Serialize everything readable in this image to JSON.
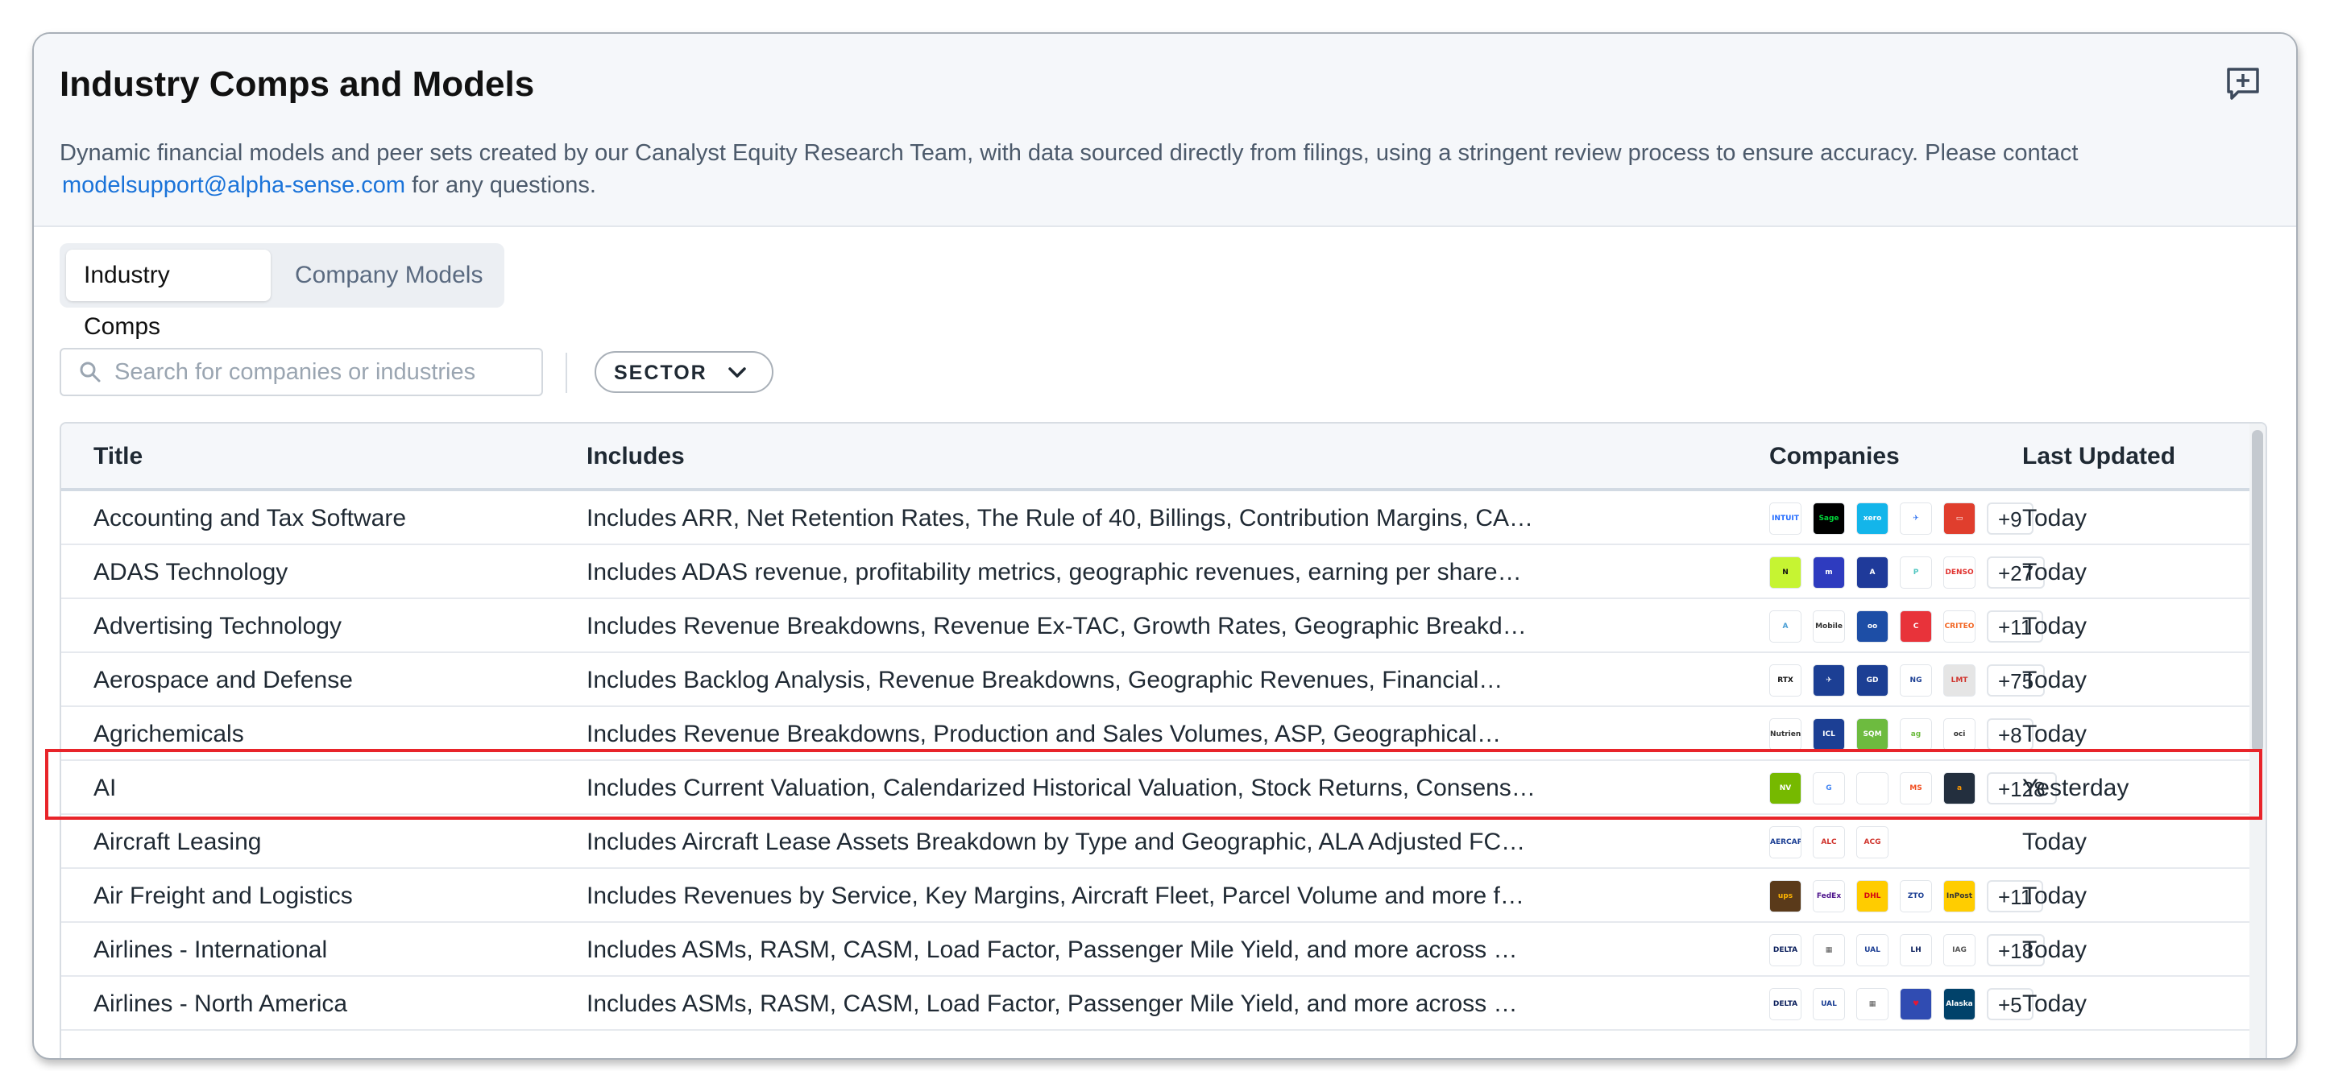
{
  "header": {
    "title": "Industry Comps and Models",
    "description": "Dynamic financial models and peer sets created by our Canalyst Equity Research Team, with data sourced directly from filings, using a stringent review process to ensure accuracy. Please contact",
    "email": "modelsupport@alpha-sense.com",
    "description_suffix": "for any questions.",
    "comment_icon": "add-comment-icon"
  },
  "tabs": [
    {
      "label": "Industry Comps",
      "active": true
    },
    {
      "label": "Company Models",
      "active": false
    }
  ],
  "search": {
    "placeholder": "Search for companies or industries",
    "value": ""
  },
  "filter": {
    "label": "SECTOR"
  },
  "table": {
    "columns": [
      "Title",
      "Includes",
      "Companies",
      "Last Updated"
    ],
    "rows": [
      {
        "title": "Accounting and Tax Software",
        "includes": "Includes ARR, Net Retention Rates, The Rule of 40, Billings, Contribution Margins, CAC…",
        "logos": [
          {
            "text": "INTUIT",
            "bg": "#ffffff",
            "fg": "#236cff"
          },
          {
            "text": "Sage",
            "bg": "#000000",
            "fg": "#00d639"
          },
          {
            "text": "xero",
            "bg": "#13b5ea",
            "fg": "#ffffff"
          },
          {
            "text": "✈",
            "bg": "#ffffff",
            "fg": "#2a6ff0"
          },
          {
            "text": "▭",
            "bg": "#e03e2d",
            "fg": "#ffffff"
          }
        ],
        "more": "+9",
        "updated": "Today"
      },
      {
        "title": "ADAS Technology",
        "includes": "Includes ADAS revenue, profitability metrics, geographic revenues, earning per share…",
        "logos": [
          {
            "text": "N",
            "bg": "#c6f432",
            "fg": "#111111"
          },
          {
            "text": "m",
            "bg": "#2e3bbf",
            "fg": "#ffffff"
          },
          {
            "text": "A",
            "bg": "#1f3a9a",
            "fg": "#ffffff"
          },
          {
            "text": "P",
            "bg": "#ffffff",
            "fg": "#4fc6c0"
          },
          {
            "text": "DENSO",
            "bg": "#ffffff",
            "fg": "#e0322f"
          }
        ],
        "more": "+27",
        "updated": "Today"
      },
      {
        "title": "Advertising Technology",
        "includes": "Includes Revenue Breakdowns, Revenue Ex-TAC, Growth Rates, Geographic Breakdown,…",
        "logos": [
          {
            "text": "A",
            "bg": "#ffffff",
            "fg": "#4b9fd5"
          },
          {
            "text": "Mobile",
            "bg": "#ffffff",
            "fg": "#333333"
          },
          {
            "text": "oo",
            "bg": "#1d4ea6",
            "fg": "#ffffff"
          },
          {
            "text": "C",
            "bg": "#e8333a",
            "fg": "#ffffff"
          },
          {
            "text": "CRITEO",
            "bg": "#ffffff",
            "fg": "#f26522"
          }
        ],
        "more": "+11",
        "updated": "Today"
      },
      {
        "title": "Aerospace and Defense",
        "includes": "Includes Backlog Analysis, Revenue Breakdowns, Geographic Revenues, Financial…",
        "logos": [
          {
            "text": "RTX",
            "bg": "#ffffff",
            "fg": "#111111"
          },
          {
            "text": "✈",
            "bg": "#1c3f94",
            "fg": "#ffffff"
          },
          {
            "text": "GD",
            "bg": "#1c3f94",
            "fg": "#ffffff"
          },
          {
            "text": "NG",
            "bg": "#ffffff",
            "fg": "#1c3f94"
          },
          {
            "text": "LMT",
            "bg": "#e5e5e5",
            "fg": "#d0352e"
          }
        ],
        "more": "+75",
        "updated": "Today"
      },
      {
        "title": "Agrichemicals",
        "includes": "Includes Revenue Breakdowns, Production and Sales Volumes, ASP, Geographical…",
        "logos": [
          {
            "text": "Nutrien",
            "bg": "#ffffff",
            "fg": "#333333"
          },
          {
            "text": "ICL",
            "bg": "#1c3f94",
            "fg": "#ffffff"
          },
          {
            "text": "SQM",
            "bg": "#6dbb3f",
            "fg": "#ffffff"
          },
          {
            "text": "ag",
            "bg": "#ffffff",
            "fg": "#6dbb3f"
          },
          {
            "text": "oci",
            "bg": "#ffffff",
            "fg": "#333333"
          }
        ],
        "more": "+8",
        "updated": "Today"
      },
      {
        "title": "AI",
        "includes": "Includes Current Valuation, Calendarized Historical Valuation, Stock Returns, Consensu…",
        "logos": [
          {
            "text": "NV",
            "bg": "#76b900",
            "fg": "#ffffff"
          },
          {
            "text": "G",
            "bg": "#ffffff",
            "fg": "#4285f4"
          },
          {
            "text": "",
            "bg": "#ffffff",
            "fg": "#111111"
          },
          {
            "text": "MS",
            "bg": "#ffffff",
            "fg": "#f25022"
          },
          {
            "text": "a",
            "bg": "#232f3e",
            "fg": "#ff9900"
          }
        ],
        "more": "+128",
        "updated": "Yesterday"
      },
      {
        "title": "Aircraft Leasing",
        "includes": "Includes Aircraft Lease Assets Breakdown by Type and Geographic, ALA Adjusted FCF,…",
        "logos": [
          {
            "text": "AERCAP",
            "bg": "#ffffff",
            "fg": "#1c3f94"
          },
          {
            "text": "ALC",
            "bg": "#ffffff",
            "fg": "#d0352e"
          },
          {
            "text": "ACG",
            "bg": "#ffffff",
            "fg": "#d0352e"
          }
        ],
        "more": "",
        "updated": "Today"
      },
      {
        "title": "Air Freight and Logistics",
        "includes": "Includes Revenues by Service, Key Margins, Aircraft Fleet, Parcel Volume and more for…",
        "logos": [
          {
            "text": "ups",
            "bg": "#5a3a1a",
            "fg": "#ffb500"
          },
          {
            "text": "FedEx",
            "bg": "#ffffff",
            "fg": "#4d148c"
          },
          {
            "text": "DHL",
            "bg": "#ffcc00",
            "fg": "#d40511"
          },
          {
            "text": "ZTO",
            "bg": "#ffffff",
            "fg": "#1c3f94"
          },
          {
            "text": "InPost",
            "bg": "#ffcd00",
            "fg": "#333333"
          }
        ],
        "more": "+11",
        "updated": "Today"
      },
      {
        "title": "Airlines - International",
        "includes": "Includes ASMs, RASM, CASM, Load Factor, Passenger Mile Yield, and more across majo…",
        "logos": [
          {
            "text": "DELTA",
            "bg": "#ffffff",
            "fg": "#0b1f5c"
          },
          {
            "text": "▦",
            "bg": "#ffffff",
            "fg": "#555555"
          },
          {
            "text": "UAL",
            "bg": "#ffffff",
            "fg": "#1c3f94"
          },
          {
            "text": "LH",
            "bg": "#ffffff",
            "fg": "#0b1f5c"
          },
          {
            "text": "IAG",
            "bg": "#ffffff",
            "fg": "#555555"
          }
        ],
        "more": "+18",
        "updated": "Today"
      },
      {
        "title": "Airlines - North America",
        "includes": "Includes ASMs, RASM, CASM, Load Factor, Passenger Mile Yield, and more across majo…",
        "logos": [
          {
            "text": "DELTA",
            "bg": "#ffffff",
            "fg": "#0b1f5c"
          },
          {
            "text": "UAL",
            "bg": "#ffffff",
            "fg": "#1c3f94"
          },
          {
            "text": "▦",
            "bg": "#ffffff",
            "fg": "#555555"
          },
          {
            "text": "♥",
            "bg": "#304cb2",
            "fg": "#e21836"
          },
          {
            "text": "Alaska",
            "bg": "#01426a",
            "fg": "#ffffff"
          }
        ],
        "more": "+5",
        "updated": "Today"
      }
    ],
    "highlighted_row": "AI"
  }
}
